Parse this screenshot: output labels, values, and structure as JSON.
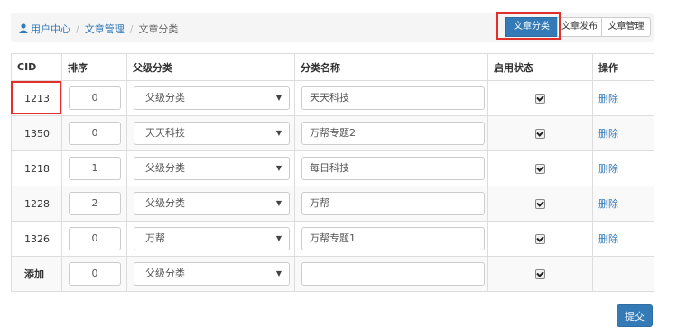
{
  "breadcrumb": {
    "user_center": "用户中心",
    "article_manage": "文章管理",
    "article_category": "文章分类",
    "separator": "/"
  },
  "toolbar": {
    "category_btn": "文章分类",
    "publish_btn": "文章发布",
    "manage_btn": "文章管理"
  },
  "table": {
    "headers": {
      "cid": "CID",
      "sort": "排序",
      "parent": "父级分类",
      "name": "分类名称",
      "enabled": "启用状态",
      "action": "操作"
    },
    "rows": [
      {
        "cid": "1213",
        "sort": "0",
        "parent": "父级分类",
        "name": "天天科技",
        "enabled": true,
        "action": "删除"
      },
      {
        "cid": "1350",
        "sort": "0",
        "parent": "天天科技",
        "name": "万帮专题2",
        "enabled": true,
        "action": "删除"
      },
      {
        "cid": "1218",
        "sort": "1",
        "parent": "父级分类",
        "name": "每日科技",
        "enabled": true,
        "action": "删除"
      },
      {
        "cid": "1228",
        "sort": "2",
        "parent": "父级分类",
        "name": "万帮",
        "enabled": true,
        "action": "删除"
      },
      {
        "cid": "1326",
        "sort": "0",
        "parent": "万帮",
        "name": "万帮专题1",
        "enabled": true,
        "action": "删除"
      }
    ],
    "add_row": {
      "cid": "添加",
      "sort": "0",
      "parent": "父级分类",
      "name": "",
      "enabled": true
    }
  },
  "submit_label": "提交",
  "icons": {
    "user": "user-icon",
    "caret": "caret-down-icon",
    "checkbox": "checkbox-checked-icon"
  },
  "colors": {
    "primary": "#337ab7",
    "highlight": "#e0302c",
    "breadcrumb_bg": "#f5f5f5"
  }
}
